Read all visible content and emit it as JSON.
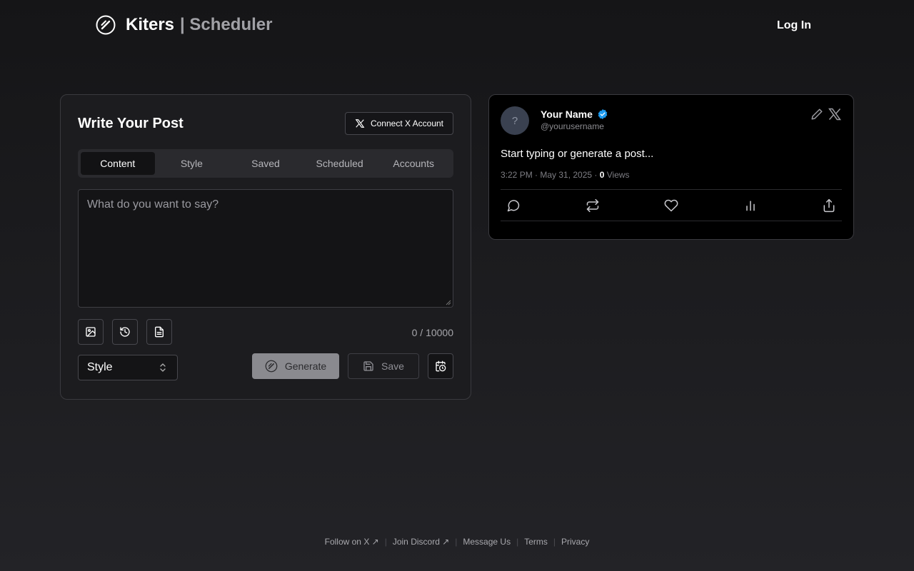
{
  "header": {
    "brand": "Kiters",
    "subtitle": "| Scheduler",
    "login_label": "Log In"
  },
  "editor": {
    "title": "Write Your Post",
    "connect_label": "Connect X Account",
    "tabs": [
      {
        "label": "Content",
        "active": true
      },
      {
        "label": "Style",
        "active": false
      },
      {
        "label": "Saved",
        "active": false
      },
      {
        "label": "Scheduled",
        "active": false
      },
      {
        "label": "Accounts",
        "active": false
      }
    ],
    "placeholder": "What do you want to say?",
    "char_count": "0 / 10000",
    "style_select": "Style",
    "generate_label": "Generate",
    "save_label": "Save"
  },
  "preview": {
    "avatar_text": "?",
    "name": "Your Name",
    "handle": "@yourusername",
    "body": "Start typing or generate a post...",
    "timestamp": "3:22 PM · May 31, 2025 · ",
    "views_count": "0",
    "views_label": " Views"
  },
  "footer": {
    "links": [
      "Follow on X ↗",
      "Join Discord ↗",
      "Message Us",
      "Terms",
      "Privacy"
    ]
  },
  "colors": {
    "accent_verified": "#1d9bf0",
    "background": "#1c1c1f"
  }
}
